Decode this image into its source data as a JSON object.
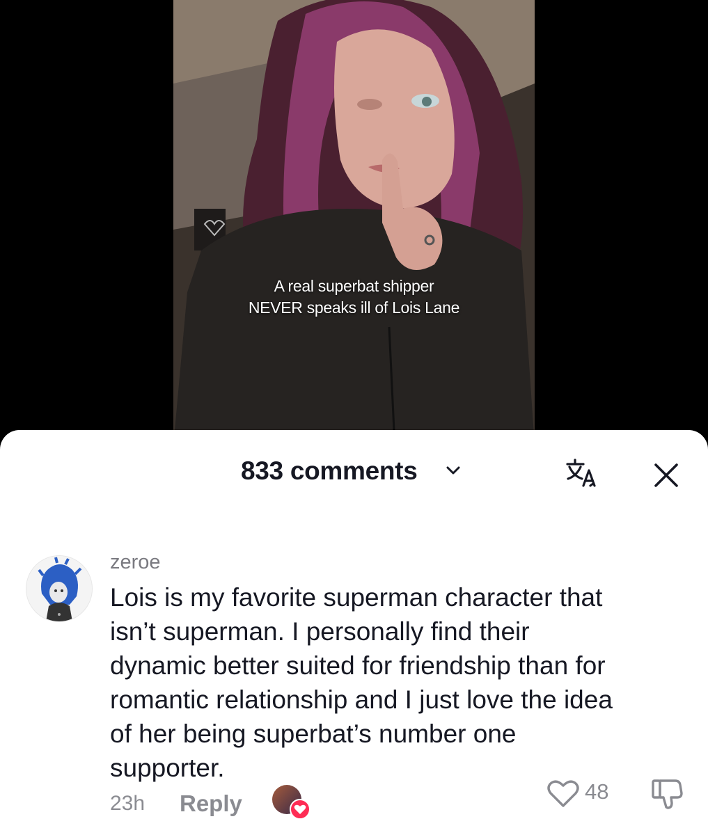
{
  "video": {
    "caption_line1": "A real superbat shipper",
    "caption_line2": "NEVER speaks ill of Lois Lane"
  },
  "sheet": {
    "comments_count_label": "833 comments"
  },
  "icons": {
    "chevron": "chevron-down-icon",
    "translate": "translate-icon",
    "close": "close-icon",
    "like": "heart-outline-icon",
    "dislike": "thumbs-down-icon"
  },
  "comment": {
    "username": "zeroe",
    "text_lines": [
      "Lois is my favorite superman character that",
      "isn’t superman. I personally find their",
      "dynamic better suited for friendship than for",
      "romantic relationship and I just love the idea",
      "of her being superbat’s number one",
      "supporter."
    ],
    "time": "23h",
    "reply_label": "Reply",
    "like_count": "48"
  },
  "colors": {
    "accent_like": "#fe2c55",
    "text_primary": "#161823",
    "text_secondary": "#8a8b91"
  }
}
